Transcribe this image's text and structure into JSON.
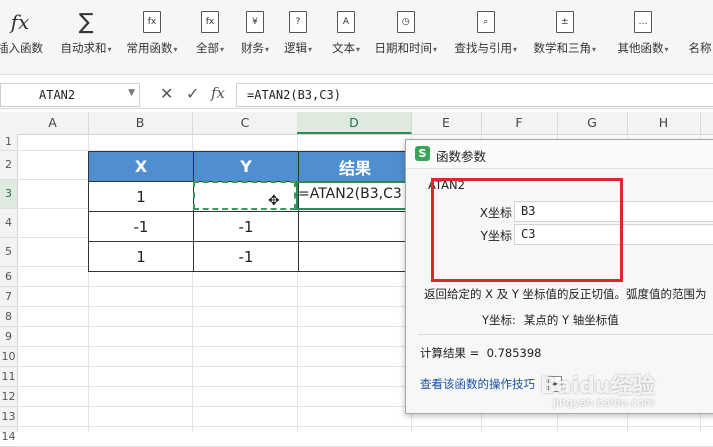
{
  "ribbon": {
    "items": [
      {
        "label": "插入函数",
        "icon": "insert-function-icon",
        "glyph": "fx",
        "dropdown": false
      },
      {
        "label": "自动求和",
        "icon": "autosum-icon",
        "glyph": "∑",
        "dropdown": true
      },
      {
        "label": "常用函数",
        "icon": "common-functions-icon",
        "glyph": "fx",
        "dropdown": true
      },
      {
        "label": "全部",
        "icon": "all-functions-icon",
        "glyph": "fx",
        "dropdown": true
      },
      {
        "label": "财务",
        "icon": "financial-icon",
        "glyph": "¥",
        "dropdown": true
      },
      {
        "label": "逻辑",
        "icon": "logical-icon",
        "glyph": "?",
        "dropdown": true
      },
      {
        "label": "文本",
        "icon": "text-icon",
        "glyph": "A",
        "dropdown": true
      },
      {
        "label": "日期和时间",
        "icon": "date-time-icon",
        "glyph": "◷",
        "dropdown": true
      },
      {
        "label": "查找与引用",
        "icon": "lookup-reference-icon",
        "glyph": "⌕",
        "dropdown": true
      },
      {
        "label": "数学和三角",
        "icon": "math-trig-icon",
        "glyph": "±",
        "dropdown": true
      },
      {
        "label": "其他函数",
        "icon": "more-functions-icon",
        "glyph": "…",
        "dropdown": true
      },
      {
        "label": "名称",
        "icon": "name-manager-icon",
        "glyph": "",
        "dropdown": false
      }
    ]
  },
  "formula_bar": {
    "name_box": "ATAN2",
    "formula": "=ATAN2(B3,C3)",
    "cancel_icon": "✕",
    "confirm_icon": "✓",
    "fx_label": "fx"
  },
  "columns": [
    "A",
    "B",
    "C",
    "D",
    "E",
    "F",
    "G",
    "H"
  ],
  "rows": [
    "1",
    "2",
    "3",
    "4",
    "5",
    "6",
    "7",
    "8",
    "9",
    "10",
    "11",
    "12",
    "13",
    "14"
  ],
  "table": {
    "headers": [
      "X",
      "Y",
      "结果"
    ],
    "rows": [
      [
        "1",
        "",
        "=ATAN2(B3,C3"
      ],
      [
        "-1",
        "-1",
        ""
      ],
      [
        "1",
        "-1",
        ""
      ]
    ]
  },
  "dialog": {
    "title": "函数参数",
    "function_name": "ATAN2",
    "args": [
      {
        "label": "X坐标",
        "value": "B3"
      },
      {
        "label": "Y坐标",
        "value": "C3"
      }
    ],
    "description": "返回给定的 X 及 Y 坐标值的反正切值。弧度值的范围为",
    "arg_desc_label": "Y坐标:",
    "arg_desc_text": "某点的 Y 轴坐标值",
    "result_label": "计算结果 =",
    "result_value": "0.785398",
    "help_link": "查看该函数的操作技巧"
  },
  "watermark": {
    "brand": "Baidu经验",
    "url": "jingyan.baidu.com"
  }
}
